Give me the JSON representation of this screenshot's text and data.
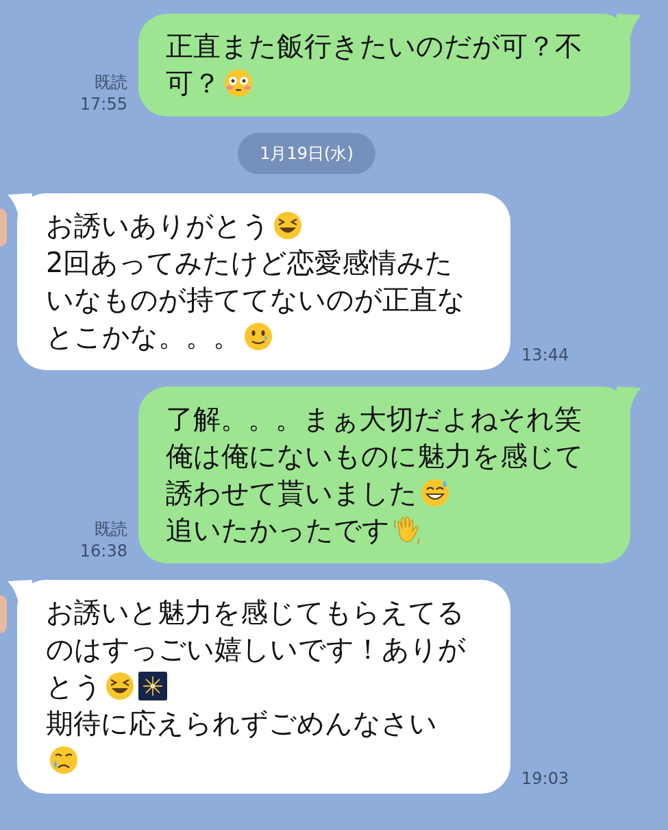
{
  "messages": [
    {
      "kind": "sent",
      "lines": [
        {
          "text": "正直また飯行きたいのだが可？不"
        },
        {
          "text": "可？",
          "emojis": [
            {
              "kind": "flushed"
            }
          ]
        }
      ],
      "read": "既読",
      "time": "17:55"
    },
    {
      "kind": "date",
      "text": "1月19日(水)"
    },
    {
      "kind": "received",
      "lines": [
        {
          "text": "お誘いありがとう",
          "emojis": [
            {
              "kind": "laughing"
            }
          ]
        },
        {
          "text": "2回あってみたけど恋愛感情みた"
        },
        {
          "text": "いなものが持ててないのが正直な"
        },
        {
          "text": "とこかな。。。",
          "emojis": [
            {
              "kind": "smiling-tear"
            }
          ]
        }
      ],
      "time": "13:44"
    },
    {
      "kind": "sent",
      "lines": [
        {
          "text": "了解。。。まぁ大切だよねそれ笑"
        },
        {
          "text": "俺は俺にないものに魅力を感じて"
        },
        {
          "text": "誘わせて貰いました",
          "emojis": [
            {
              "kind": "sweat-smile"
            }
          ]
        },
        {
          "text": "追いたかったです",
          "emojis": [
            {
              "kind": "waving-hand"
            }
          ]
        }
      ],
      "read": "既読",
      "time": "16:38"
    },
    {
      "kind": "received",
      "lines": [
        {
          "text": "お誘いと魅力を感じてもらえてる"
        },
        {
          "text": "のはすっごい嬉しいです！ありが"
        },
        {
          "text": "とう",
          "emojis": [
            {
              "kind": "laughing"
            },
            {
              "kind": "fireworks"
            }
          ]
        },
        {
          "text": "期待に応えられずごめんなさい"
        },
        {
          "emojis": [
            {
              "kind": "crying"
            }
          ]
        }
      ],
      "time": "19:03"
    }
  ]
}
